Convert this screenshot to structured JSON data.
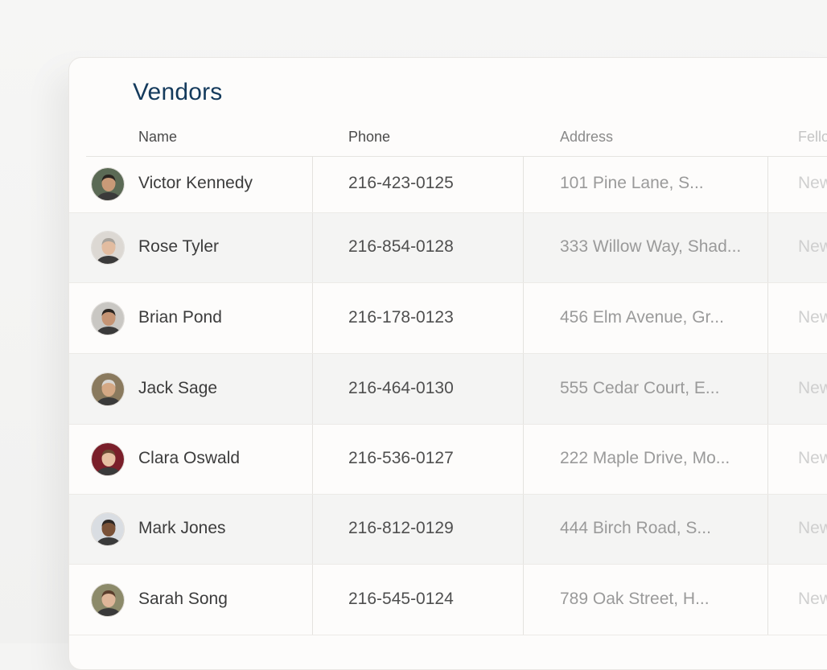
{
  "title": "Vendors",
  "columns": {
    "name": "Name",
    "phone": "Phone",
    "address": "Address",
    "fellow": "Fello"
  },
  "rows": [
    {
      "name": "Victor Kennedy",
      "phone": "216-423-0125",
      "address": "101 Pine Lane, S...",
      "fellow": "New",
      "avatar_bg": "#5b6a55",
      "skin": "#c99a78",
      "hair": "#2a2420"
    },
    {
      "name": "Rose Tyler",
      "phone": "216-854-0128",
      "address": "333 Willow Way, Shad...",
      "fellow": "New",
      "avatar_bg": "#dcd8d3",
      "skin": "#e2bca0",
      "hair": "#a8a39c"
    },
    {
      "name": "Brian Pond",
      "phone": "216-178-0123",
      "address": "456 Elm Avenue, Gr...",
      "fellow": "New",
      "avatar_bg": "#c9c7c3",
      "skin": "#c59474",
      "hair": "#2b2521"
    },
    {
      "name": "Jack Sage",
      "phone": "216-464-0130",
      "address": "555 Cedar Court, E...",
      "fellow": "New",
      "avatar_bg": "#8a7a5e",
      "skin": "#d4a884",
      "hair": "#d8d6d2"
    },
    {
      "name": "Clara Oswald",
      "phone": "216-536-0127",
      "address": "222 Maple Drive, Mo...",
      "fellow": "New",
      "avatar_bg": "#7a1f2a",
      "skin": "#e6bfa2",
      "hair": "#6b4a33"
    },
    {
      "name": "Mark Jones",
      "phone": "216-812-0129",
      "address": "444 Birch Road, S...",
      "fellow": "New",
      "avatar_bg": "#d9dde2",
      "skin": "#7a5238",
      "hair": "#2d2724"
    },
    {
      "name": "Sarah Song",
      "phone": "216-545-0124",
      "address": "789 Oak Street, H...",
      "fellow": "New",
      "avatar_bg": "#8c8a6a",
      "skin": "#deb699",
      "hair": "#5a3e2c"
    }
  ]
}
